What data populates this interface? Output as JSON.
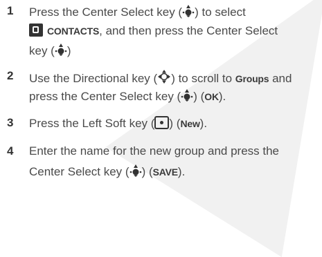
{
  "steps": [
    {
      "number": "1",
      "lines": [
        {
          "pre": "Press the Center Select key (",
          "post": ") to select"
        },
        {
          "strong": "CONTACTS",
          "post": ", and then press the Center Select"
        },
        {
          "pre": "key (",
          "post": ")"
        }
      ]
    },
    {
      "number": "2",
      "lines": [
        {
          "pre": "Use the Directional key (",
          "mid": ") to scroll to ",
          "strong": "Groups",
          "post": " and"
        },
        {
          "pre": "press the Center Select key (",
          "mid": ") (",
          "strong": "OK",
          "post": ")."
        }
      ]
    },
    {
      "number": "3",
      "lines": [
        {
          "pre": "Press the Left Soft key (",
          "mid": ") (",
          "strong": "New",
          "post": ")."
        }
      ]
    },
    {
      "number": "4",
      "lines": [
        {
          "pre": "Enter the name for the new group and press the"
        },
        {
          "pre": "Center Select key (",
          "mid": ") (",
          "strong": "SAVE",
          "post": ")."
        }
      ]
    }
  ],
  "icons": {
    "center_select": "center-select-key-icon",
    "directional": "directional-key-icon",
    "contacts": "contacts-icon",
    "left_soft": "left-soft-key-icon"
  }
}
